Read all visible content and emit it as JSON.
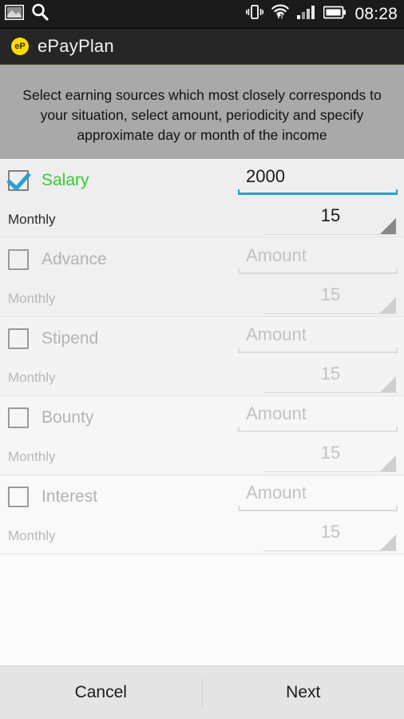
{
  "status_bar": {
    "icons_left": [
      "image-thumbnail-icon",
      "search-icon"
    ],
    "icons_right": [
      "vibrate-icon",
      "wifi-icon",
      "signal-icon",
      "battery-icon"
    ],
    "clock": "08:28"
  },
  "action_bar": {
    "logo_text": "eP",
    "title": "ePayPlan",
    "logo_color": "#ffdd00",
    "background": "#262626"
  },
  "instructions": {
    "text": "Select earning sources which most closely corresponds to your situation, select amount, periodicity and specify approximate day or month of the income",
    "background": "#a9a9a9"
  },
  "colors": {
    "accent_blue": "#2a9fd6",
    "active_green": "#33cc33",
    "disabled_gray": "#b3b3b3"
  },
  "income_sources": [
    {
      "label": "Salary",
      "checked": true,
      "enabled": true,
      "amount_value": "2000",
      "amount_placeholder": "Amount",
      "periodicity": "Monthly",
      "day_value": "15"
    },
    {
      "label": "Advance",
      "checked": false,
      "enabled": false,
      "amount_value": "",
      "amount_placeholder": "Amount",
      "periodicity": "Monthly",
      "day_value": "15"
    },
    {
      "label": "Stipend",
      "checked": false,
      "enabled": false,
      "amount_value": "",
      "amount_placeholder": "Amount",
      "periodicity": "Monthly",
      "day_value": "15"
    },
    {
      "label": "Bounty",
      "checked": false,
      "enabled": false,
      "amount_value": "",
      "amount_placeholder": "Amount",
      "periodicity": "Monthly",
      "day_value": "15"
    },
    {
      "label": "Interest",
      "checked": false,
      "enabled": false,
      "amount_value": "",
      "amount_placeholder": "Amount",
      "periodicity": "Monthly",
      "day_value": "15"
    }
  ],
  "buttons": {
    "cancel_label": "Cancel",
    "next_label": "Next"
  }
}
